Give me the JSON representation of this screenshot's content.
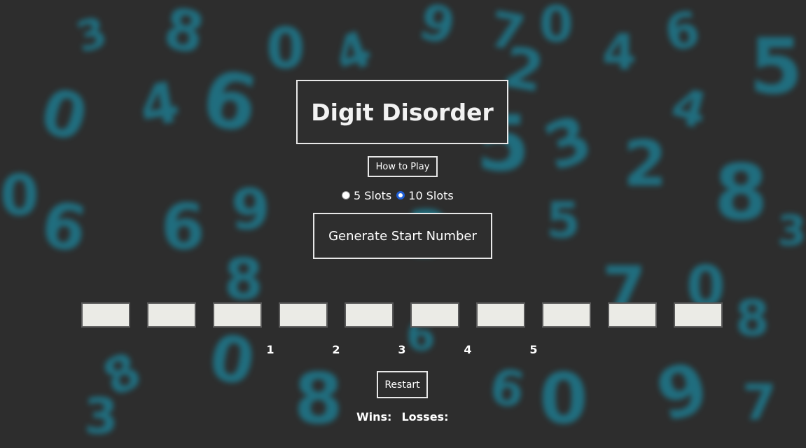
{
  "title": "Digit Disorder",
  "how_to_play_label": "How to Play",
  "slot_options": [
    {
      "label": "5 Slots",
      "selected": false
    },
    {
      "label": "10 Slots",
      "selected": true
    }
  ],
  "generate_label": "Generate Start Number",
  "slots": [
    "",
    "",
    "",
    "",
    "",
    "",
    "",
    "",
    "",
    ""
  ],
  "number_labels": [
    "1",
    "2",
    "3",
    "4",
    "5"
  ],
  "restart_label": "Restart",
  "score": {
    "wins_label": "Wins:",
    "losses_label": "Losses:"
  },
  "colors": {
    "background": "#2d2d2d",
    "accent_digits": "#16a3c2",
    "radio_selected": "#1f5fd6",
    "slot_fill": "#ebebe6"
  }
}
